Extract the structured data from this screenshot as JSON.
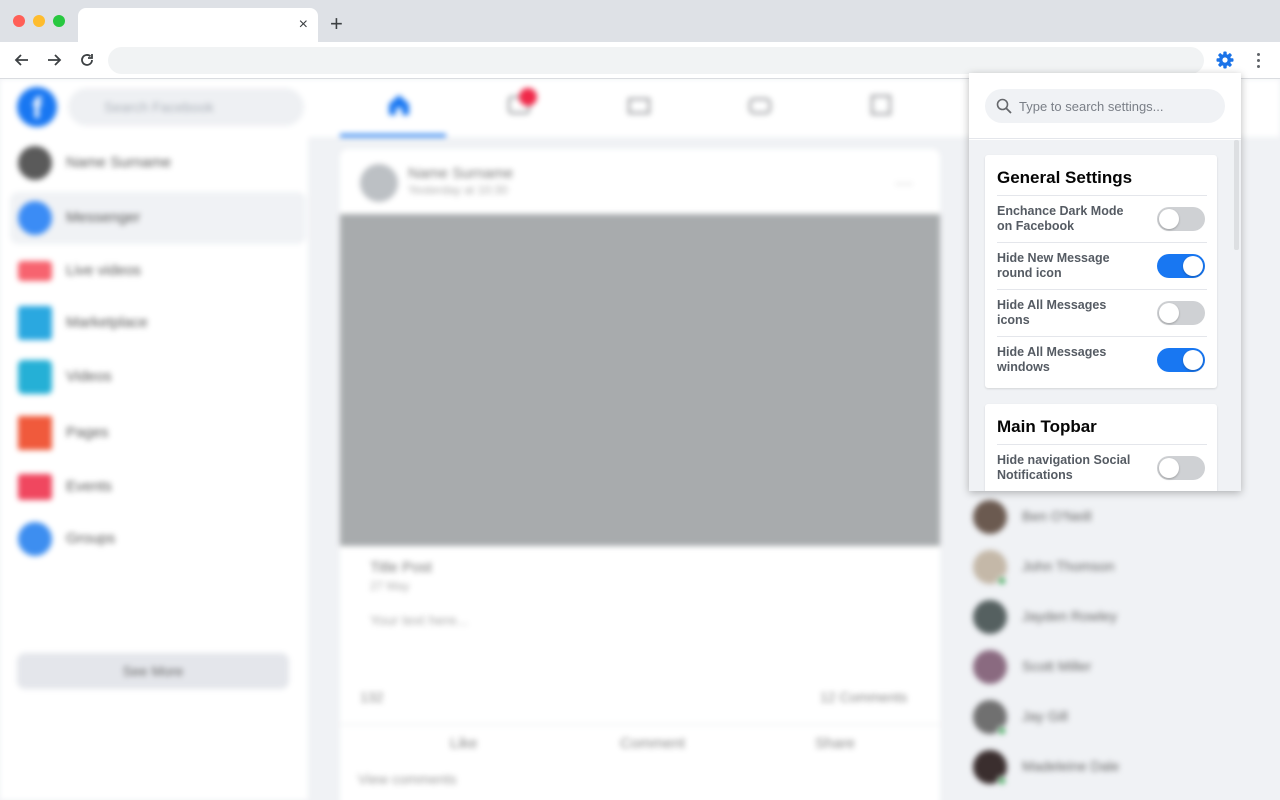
{
  "browser": {
    "tab_close": "×",
    "new_tab": "+"
  },
  "facebook": {
    "search_placeholder": "Search Facebook",
    "sidebar": [
      {
        "label": "Name Surname",
        "icon": "profile-avatar",
        "color": "#5a5a5a"
      },
      {
        "label": "Messenger",
        "icon": "messenger-icon",
        "color": "#3b8cf5",
        "active": true
      },
      {
        "label": "Live videos",
        "icon": "live-video-icon",
        "color": "#f7636f"
      },
      {
        "label": "Marketplace",
        "icon": "marketplace-icon",
        "color": "#2aa8e0"
      },
      {
        "label": "Videos",
        "icon": "video-icon",
        "color": "#25b0d6"
      },
      {
        "label": "Pages",
        "icon": "pages-flag-icon",
        "color": "#f05a3c"
      },
      {
        "label": "Events",
        "icon": "events-icon",
        "color": "#f0475f"
      },
      {
        "label": "Groups",
        "icon": "groups-icon",
        "color": "#3d8ef0"
      }
    ],
    "see_more": "See More",
    "post": {
      "author": "Name Surname",
      "time": "Yesterday at 10:30",
      "more": "···",
      "title": "Title Post",
      "date": "27 May",
      "text": "Your text here...",
      "like_count": "132",
      "comment_count": "12 Comments",
      "like": "Like",
      "comment": "Comment",
      "share": "Share",
      "view_comments": "View comments"
    },
    "contacts": [
      {
        "name": "Ben O'Neill",
        "online": false,
        "color": "#6b5a50"
      },
      {
        "name": "John Thomson",
        "online": true,
        "color": "#c4b8a8"
      },
      {
        "name": "Jayden Rowley",
        "online": false,
        "color": "#556060"
      },
      {
        "name": "Scott Miller",
        "online": false,
        "color": "#8a6a80"
      },
      {
        "name": "Jay Gill",
        "online": true,
        "color": "#707070"
      },
      {
        "name": "Madeleine Dale",
        "online": true,
        "color": "#3a2e2e"
      }
    ]
  },
  "settings": {
    "search_placeholder": "Type to search settings...",
    "general": {
      "title": "General Settings",
      "items": [
        {
          "label": "Enchance Dark Mode on Facebook",
          "enabled": false
        },
        {
          "label": "Hide New Message round icon",
          "enabled": true
        },
        {
          "label": "Hide All Messages icons",
          "enabled": false
        },
        {
          "label": "Hide All Messages windows",
          "enabled": true
        }
      ]
    },
    "topbar": {
      "title": "Main Topbar",
      "items": [
        {
          "label": "Hide navigation Social Notifications",
          "enabled": false
        }
      ]
    }
  },
  "colors": {
    "accent": "#1877f2",
    "toggle_off": "#cfd1d4",
    "extension_gear": "#1a73e8"
  }
}
